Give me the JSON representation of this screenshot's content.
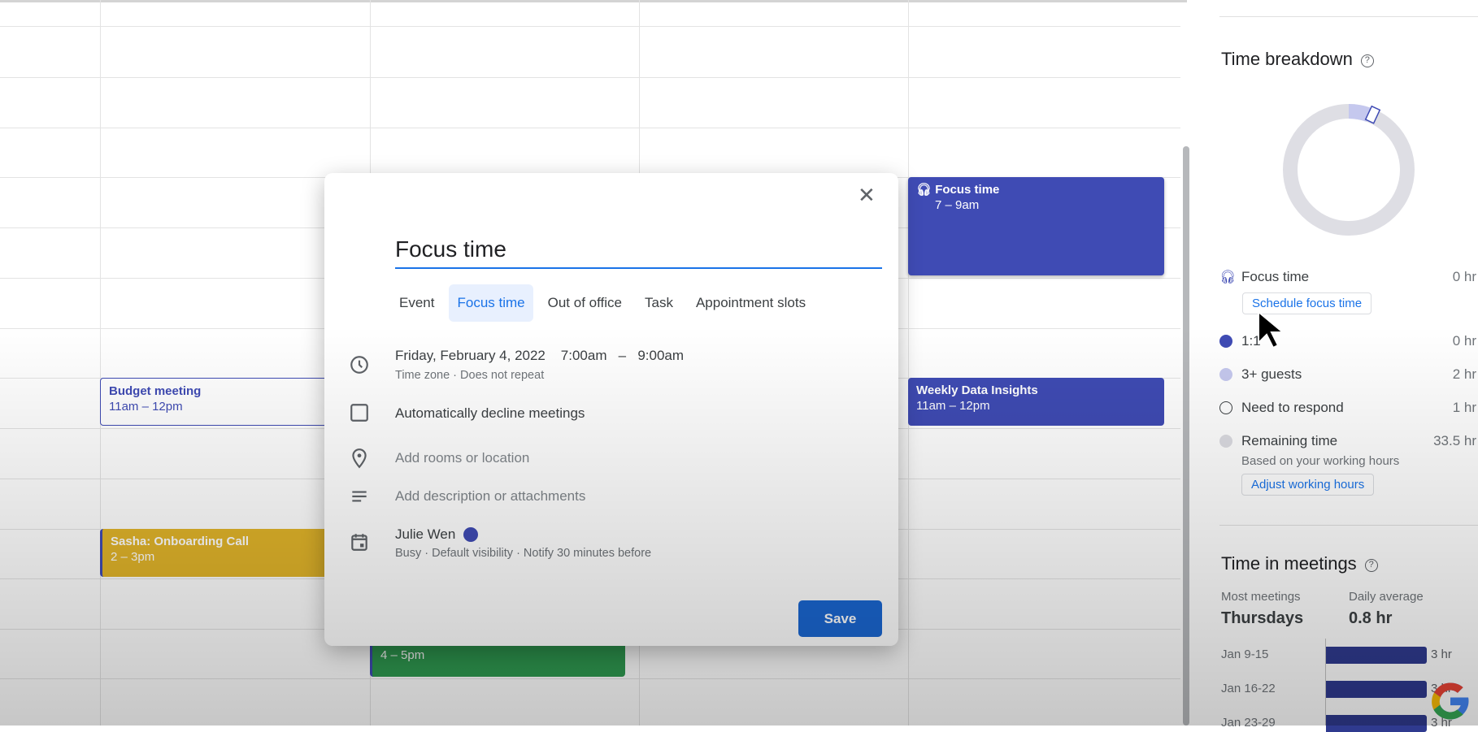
{
  "calendar": {
    "events": [
      {
        "title": "Focus time",
        "time": "7 – 9am",
        "icon": "headphones-icon"
      },
      {
        "title": "Weekly Data Insights",
        "time": "11am – 12pm"
      },
      {
        "title": "Budget meeting",
        "time": "11am – 12pm"
      },
      {
        "title": "Sasha: Onboarding Call",
        "time": "2 – 3pm"
      },
      {
        "title": "",
        "time": "4 – 5pm"
      }
    ]
  },
  "dialog": {
    "title": "Focus time",
    "close_icon": "close-icon",
    "tabs": [
      {
        "label": "Event"
      },
      {
        "label": "Focus time",
        "active": true
      },
      {
        "label": "Out of office"
      },
      {
        "label": "Task"
      },
      {
        "label": "Appointment slots"
      }
    ],
    "date": "Friday, February 4, 2022",
    "start": "7:00am",
    "dash": "–",
    "end": "9:00am",
    "time_sub": "Time zone · Does not repeat",
    "auto_decline": "Automatically decline meetings",
    "location_placeholder": "Add rooms or location",
    "description_placeholder": "Add description or attachments",
    "calendar_owner": "Julie Wen",
    "calendar_color": "#3f4bb4",
    "calendar_sub": "Busy · Default visibility · Notify 30 minutes before",
    "save_label": "Save"
  },
  "panel": {
    "time_breakdown": {
      "title": "Time breakdown",
      "help": "?",
      "items": [
        {
          "label": "Focus time",
          "value": "0 hr",
          "button": "Schedule focus time"
        },
        {
          "label": "1:1",
          "value": "0 hr",
          "color": "#3f4bb4"
        },
        {
          "label": "3+ guests",
          "value": "2 hr",
          "color": "#c5c8ee"
        },
        {
          "label": "Need to respond",
          "value": "1 hr"
        },
        {
          "label": "Remaining time",
          "value": "33.5 hr",
          "sub": "Based on your working hours",
          "button": "Adjust working hours",
          "color": "#dcdce2"
        }
      ]
    },
    "time_in_meetings": {
      "title": "Time in meetings",
      "help": "?",
      "most_label": "Most meetings",
      "most_value": "Thursdays",
      "avg_label": "Daily average",
      "avg_value": "0.8 hr",
      "weeks": [
        {
          "label": "Jan 9-15",
          "hours": 3,
          "value": "3 hr"
        },
        {
          "label": "Jan 16-22",
          "hours": 3,
          "value": "3 hr"
        },
        {
          "label": "Jan 23-29",
          "hours": 3,
          "value": "3 hr"
        }
      ]
    }
  }
}
